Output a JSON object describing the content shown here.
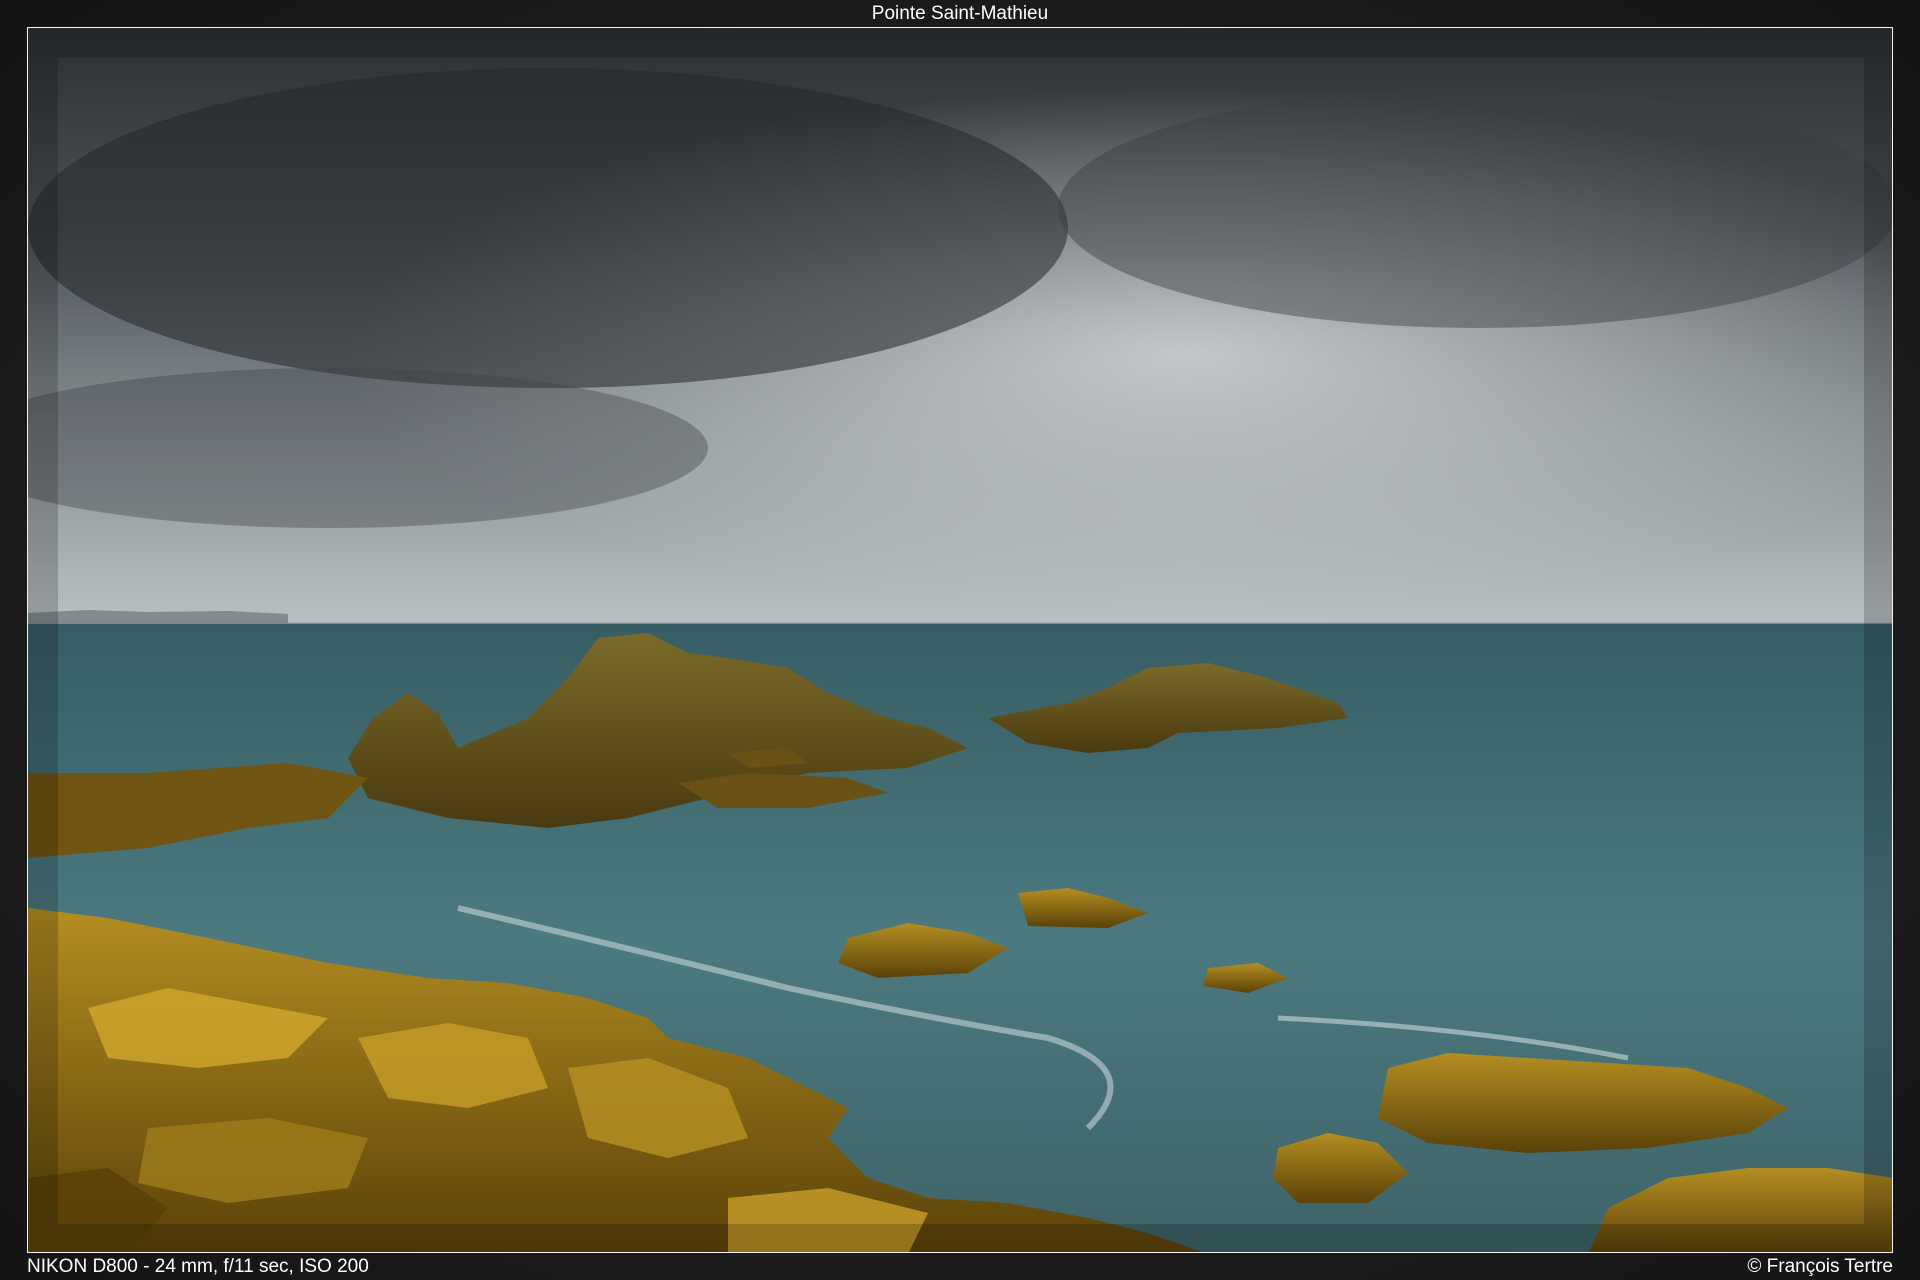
{
  "title": "Pointe Saint-Mathieu",
  "exif": "NIKON D800 - 24 mm, f/11 sec, ISO 200",
  "copyright": "© François Tertre",
  "colors": {
    "sky_dark": "#2b2e31",
    "sky_light": "#c9ced0",
    "sea": "#3c6b70",
    "rock": "#8a6a12",
    "rock_highlight": "#c9a02a"
  }
}
